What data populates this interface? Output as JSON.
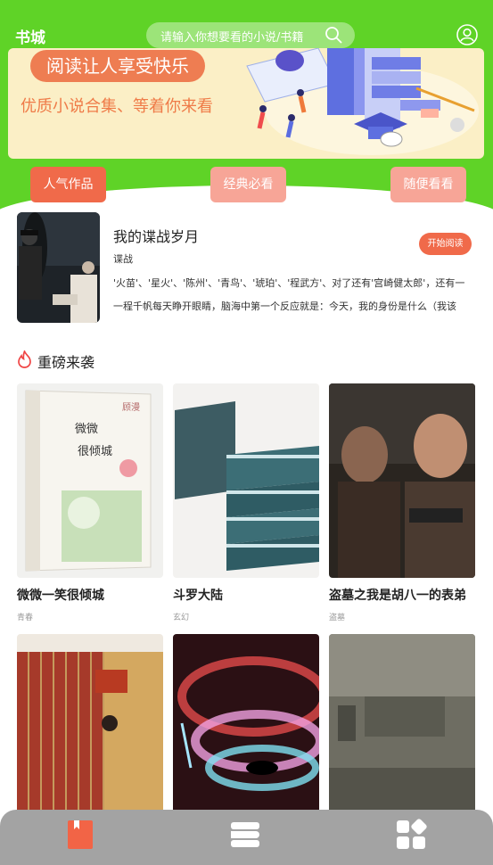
{
  "header": {
    "title": "书城",
    "search_placeholder": "请输入你想要看的小说/书籍"
  },
  "banner": {
    "headline": "阅读让人享受快乐",
    "subline": "优质小说合集、等着你来看"
  },
  "tabs": [
    {
      "label": "人气作品",
      "active": true
    },
    {
      "label": "经典必看",
      "active": false
    },
    {
      "label": "随便看看",
      "active": false
    }
  ],
  "featured": {
    "title": "我的谍战岁月",
    "tag": "谍战",
    "description": "'火苗'、'星火'、'陈州'、'青鸟'、'琥珀'、'程武方'、对了还有'宫崎健太郎'，还有一一程千帆每天睁开眼睛，脑海中第一个反应就是：今天，我的身份是什么（我该穿…",
    "button": "开始阅读"
  },
  "section": {
    "title": "重磅来袭"
  },
  "books": [
    {
      "title": "微微一笑很倾城",
      "genre": "青春"
    },
    {
      "title": "斗罗大陆",
      "genre": "玄幻"
    },
    {
      "title": "盗墓之我是胡八一的表弟",
      "genre": "盗墓"
    },
    {
      "title": "",
      "genre": ""
    },
    {
      "title": "",
      "genre": ""
    },
    {
      "title": "",
      "genre": ""
    }
  ],
  "colors": {
    "accent": "#5fd327",
    "tab_active": "#f06a4a",
    "tab_inactive": "#f7a597",
    "nav_bg": "#a3a3a3"
  },
  "nav": [
    {
      "icon": "bookmark-icon",
      "active": true
    },
    {
      "icon": "list-icon",
      "active": false
    },
    {
      "icon": "apps-icon",
      "active": false
    }
  ]
}
